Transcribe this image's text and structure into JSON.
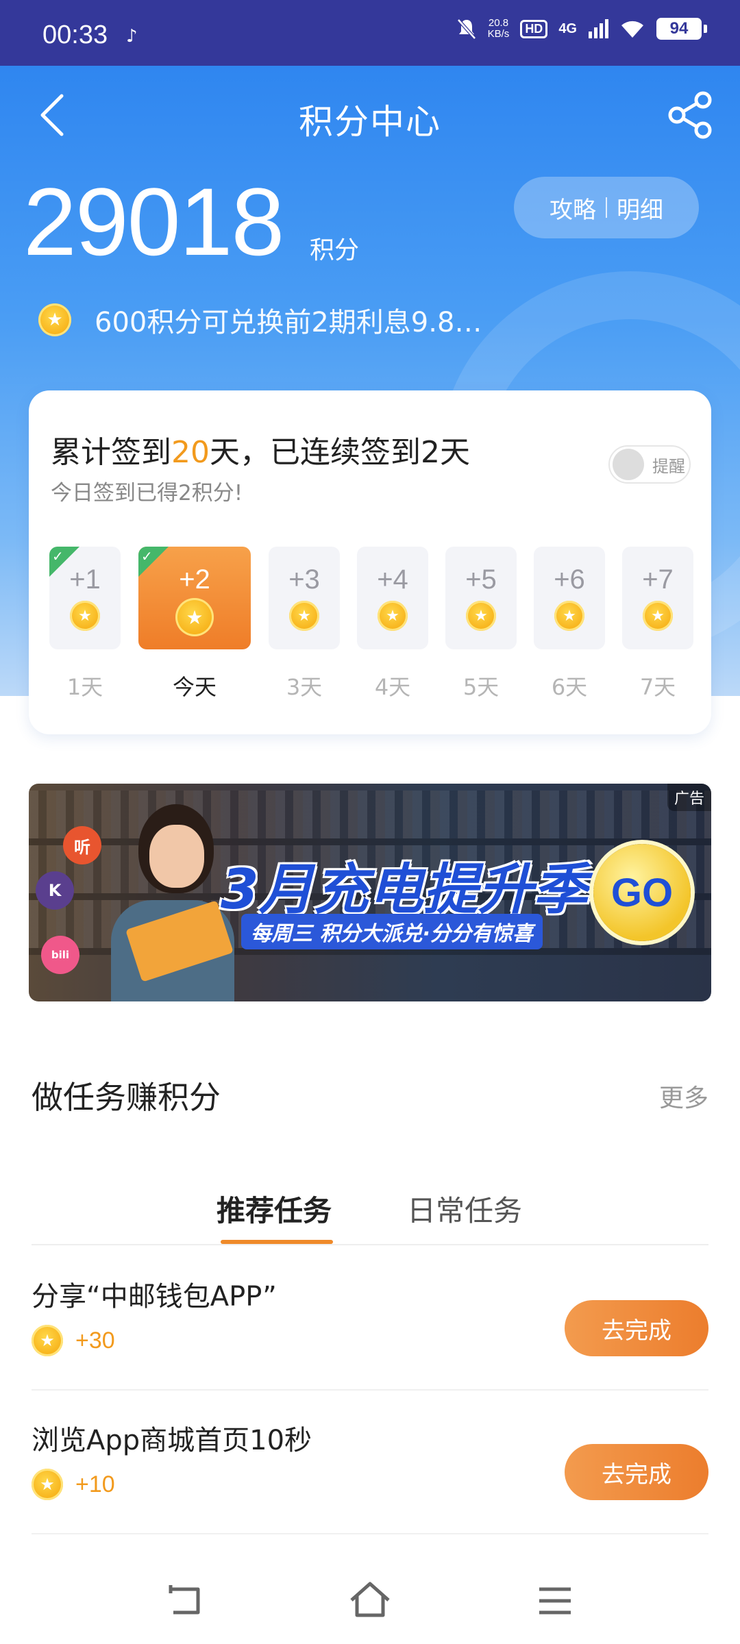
{
  "status_bar": {
    "time": "00:33",
    "speed_value": "20.8",
    "speed_unit": "KB/s",
    "hd": "HD",
    "network": "4G",
    "battery": "94"
  },
  "header": {
    "title": "积分中心"
  },
  "points": {
    "value": "29018",
    "unit": "积分",
    "guide_label": "攻略",
    "detail_label": "明细",
    "notice": "600积分可兑换前2期利息9.8…"
  },
  "sign_in": {
    "title_prefix": "累计签到",
    "total_days": "20",
    "title_suffix": "天，已连续签到2天",
    "subtitle": "今日签到已得2积分!",
    "remind_label": "提醒",
    "days": [
      {
        "reward": "+1",
        "label": "1天",
        "checked": true
      },
      {
        "reward": "+2",
        "label": "今天",
        "checked": true
      },
      {
        "reward": "+3",
        "label": "3天",
        "checked": false
      },
      {
        "reward": "+4",
        "label": "4天",
        "checked": false
      },
      {
        "reward": "+5",
        "label": "5天",
        "checked": false
      },
      {
        "reward": "+6",
        "label": "6天",
        "checked": false
      },
      {
        "reward": "+7",
        "label": "7天",
        "checked": false
      }
    ]
  },
  "ad": {
    "tag": "广告",
    "title": "3月充电提升季",
    "subtitle": "每周三 积分大派兑·分分有惊喜",
    "go": "GO",
    "icon_listen": "听",
    "icon_k": "K",
    "icon_bili": "bili"
  },
  "tasks": {
    "section_title": "做任务赚积分",
    "more": "更多",
    "tabs": [
      {
        "label": "推荐任务",
        "active": true
      },
      {
        "label": "日常任务",
        "active": false
      }
    ],
    "items": [
      {
        "name": "分享“中邮钱包APP”",
        "points": "+30",
        "button": "去完成"
      },
      {
        "name": "浏览App商城首页10秒",
        "points": "+10",
        "button": "去完成"
      }
    ]
  },
  "colors": {
    "status_bar": "#34389a",
    "header_blue": "#2f86f0",
    "accent_orange": "#ef7d28",
    "check_green": "#45b76a"
  }
}
